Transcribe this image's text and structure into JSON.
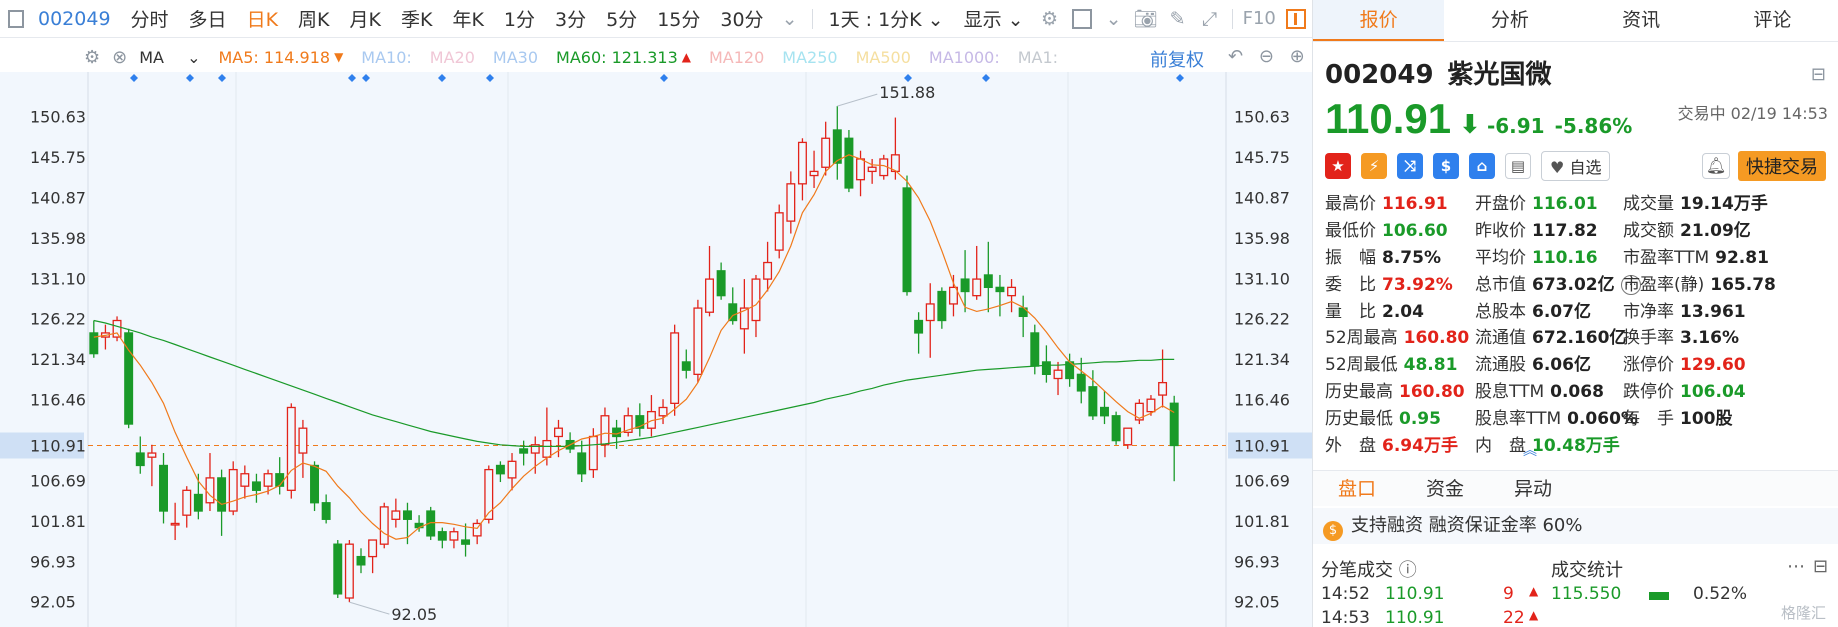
{
  "toolbar": {
    "code": "002049",
    "items": [
      "分时",
      "多日",
      "日K",
      "周K",
      "月K",
      "季K",
      "年K",
      "1分",
      "3分",
      "5分",
      "15分",
      "30分"
    ],
    "active_item": "日K",
    "dropdown_1": "1天 : 1分K",
    "dropdown_2": "显示",
    "f10": "F10"
  },
  "ma_bar": {
    "indicator": "MA",
    "ma5": "MA5: 114.918",
    "ma10": "MA10:",
    "ma20": "MA20",
    "ma30": "MA30",
    "ma60": "MA60: 121.313",
    "ma120": "MA120",
    "ma250": "MA250",
    "ma500": "MA500",
    "ma1000": "MA1000:",
    "ma1": "MA1:",
    "adjust": "前复权",
    "colors": {
      "ma5": "#f07a1b",
      "ma60": "#1a9a29",
      "faded": [
        "#a9c9f0",
        "#f0c7d6",
        "#a9c9f0",
        "#f5b8b8",
        "#a6e3f0",
        "#f5dfa0",
        "#c6b9e6",
        "#c4c9cf"
      ]
    }
  },
  "chart_data": {
    "type": "candlestick",
    "price_levels": [
      150.63,
      145.75,
      140.87,
      135.98,
      131.1,
      126.22,
      121.34,
      116.46,
      110.91,
      106.69,
      101.81,
      96.93,
      92.05
    ],
    "current_price_label": "110.91",
    "high_label": "151.88",
    "low_label": "92.05",
    "ylim": [
      89.0,
      156.0
    ],
    "up_color": "#e2231a",
    "down_color": "#1a9a29",
    "candles": [
      {
        "o": 124.5,
        "h": 126.0,
        "l": 121.5,
        "c": 122.0
      },
      {
        "o": 124.0,
        "h": 125.5,
        "l": 122.5,
        "c": 124.5
      },
      {
        "o": 124.0,
        "h": 126.5,
        "l": 123.5,
        "c": 126.0
      },
      {
        "o": 124.5,
        "h": 125.0,
        "l": 113.0,
        "c": 113.5
      },
      {
        "o": 110.0,
        "h": 112.0,
        "l": 107.5,
        "c": 108.5
      },
      {
        "o": 109.5,
        "h": 111.0,
        "l": 106.0,
        "c": 110.0
      },
      {
        "o": 108.5,
        "h": 110.0,
        "l": 101.5,
        "c": 103.0
      },
      {
        "o": 101.5,
        "h": 104.0,
        "l": 99.5,
        "c": 101.5
      },
      {
        "o": 102.5,
        "h": 106.0,
        "l": 101.0,
        "c": 105.5
      },
      {
        "o": 105.0,
        "h": 107.5,
        "l": 102.0,
        "c": 103.0
      },
      {
        "o": 104.0,
        "h": 110.0,
        "l": 103.0,
        "c": 107.0
      },
      {
        "o": 107.0,
        "h": 108.0,
        "l": 100.0,
        "c": 103.0
      },
      {
        "o": 103.0,
        "h": 109.0,
        "l": 102.5,
        "c": 108.0
      },
      {
        "o": 106.0,
        "h": 108.5,
        "l": 104.5,
        "c": 107.5
      },
      {
        "o": 106.5,
        "h": 107.5,
        "l": 104.0,
        "c": 105.5
      },
      {
        "o": 106.0,
        "h": 108.0,
        "l": 105.0,
        "c": 107.5
      },
      {
        "o": 107.5,
        "h": 109.5,
        "l": 105.0,
        "c": 106.0
      },
      {
        "o": 105.5,
        "h": 116.0,
        "l": 104.5,
        "c": 115.5
      },
      {
        "o": 110.0,
        "h": 114.0,
        "l": 107.0,
        "c": 113.0
      },
      {
        "o": 108.5,
        "h": 109.0,
        "l": 103.0,
        "c": 104.0
      },
      {
        "o": 104.0,
        "h": 105.0,
        "l": 101.5,
        "c": 102.0
      },
      {
        "o": 99.0,
        "h": 99.5,
        "l": 92.5,
        "c": 93.0
      },
      {
        "o": 92.5,
        "h": 99.5,
        "l": 92.0,
        "c": 99.0
      },
      {
        "o": 97.5,
        "h": 98.5,
        "l": 95.5,
        "c": 96.5
      },
      {
        "o": 97.5,
        "h": 99.5,
        "l": 95.5,
        "c": 99.5
      },
      {
        "o": 99.0,
        "h": 104.0,
        "l": 98.5,
        "c": 103.5
      },
      {
        "o": 102.0,
        "h": 104.5,
        "l": 101.0,
        "c": 103.0
      },
      {
        "o": 103.0,
        "h": 104.0,
        "l": 99.0,
        "c": 102.0
      },
      {
        "o": 101.5,
        "h": 102.5,
        "l": 100.5,
        "c": 101.0
      },
      {
        "o": 103.0,
        "h": 103.5,
        "l": 99.5,
        "c": 100.0
      },
      {
        "o": 100.5,
        "h": 101.0,
        "l": 98.5,
        "c": 99.5
      },
      {
        "o": 99.5,
        "h": 101.0,
        "l": 98.5,
        "c": 100.5
      },
      {
        "o": 99.5,
        "h": 101.5,
        "l": 97.5,
        "c": 99.0
      },
      {
        "o": 100.0,
        "h": 102.0,
        "l": 99.0,
        "c": 101.5
      },
      {
        "o": 102.0,
        "h": 108.5,
        "l": 101.5,
        "c": 108.0
      },
      {
        "o": 108.5,
        "h": 109.0,
        "l": 106.5,
        "c": 107.5
      },
      {
        "o": 107.0,
        "h": 110.0,
        "l": 105.5,
        "c": 109.0
      },
      {
        "o": 110.5,
        "h": 111.5,
        "l": 108.5,
        "c": 110.0
      },
      {
        "o": 110.0,
        "h": 112.0,
        "l": 107.5,
        "c": 111.0
      },
      {
        "o": 109.5,
        "h": 115.5,
        "l": 108.5,
        "c": 111.5
      },
      {
        "o": 112.0,
        "h": 114.0,
        "l": 109.5,
        "c": 113.0
      },
      {
        "o": 111.5,
        "h": 112.5,
        "l": 110.0,
        "c": 110.5
      },
      {
        "o": 110.0,
        "h": 111.5,
        "l": 106.5,
        "c": 107.5
      },
      {
        "o": 108.0,
        "h": 113.0,
        "l": 107.0,
        "c": 112.0
      },
      {
        "o": 111.0,
        "h": 115.5,
        "l": 109.5,
        "c": 114.5
      },
      {
        "o": 113.0,
        "h": 114.0,
        "l": 110.5,
        "c": 112.0
      },
      {
        "o": 112.5,
        "h": 115.5,
        "l": 112.0,
        "c": 114.5
      },
      {
        "o": 114.5,
        "h": 116.0,
        "l": 112.0,
        "c": 113.0
      },
      {
        "o": 113.0,
        "h": 117.0,
        "l": 112.0,
        "c": 115.0
      },
      {
        "o": 114.5,
        "h": 116.5,
        "l": 113.5,
        "c": 115.5
      },
      {
        "o": 116.0,
        "h": 125.5,
        "l": 114.5,
        "c": 124.5
      },
      {
        "o": 121.0,
        "h": 122.5,
        "l": 119.0,
        "c": 120.0
      },
      {
        "o": 119.5,
        "h": 128.5,
        "l": 118.5,
        "c": 127.5
      },
      {
        "o": 127.0,
        "h": 135.0,
        "l": 126.5,
        "c": 131.0
      },
      {
        "o": 132.0,
        "h": 133.0,
        "l": 128.5,
        "c": 129.0
      },
      {
        "o": 128.0,
        "h": 130.0,
        "l": 125.5,
        "c": 126.0
      },
      {
        "o": 125.0,
        "h": 131.0,
        "l": 122.0,
        "c": 127.5
      },
      {
        "o": 126.0,
        "h": 131.5,
        "l": 124.0,
        "c": 131.0
      },
      {
        "o": 131.0,
        "h": 135.5,
        "l": 129.5,
        "c": 133.0
      },
      {
        "o": 134.5,
        "h": 140.0,
        "l": 133.5,
        "c": 139.0
      },
      {
        "o": 138.0,
        "h": 144.0,
        "l": 136.5,
        "c": 142.5
      },
      {
        "o": 142.5,
        "h": 148.0,
        "l": 140.5,
        "c": 147.5
      },
      {
        "o": 143.5,
        "h": 146.5,
        "l": 142.0,
        "c": 144.0
      },
      {
        "o": 144.5,
        "h": 150.0,
        "l": 143.5,
        "c": 148.0
      },
      {
        "o": 149.0,
        "h": 151.88,
        "l": 143.0,
        "c": 145.0
      },
      {
        "o": 148.0,
        "h": 149.0,
        "l": 141.5,
        "c": 142.0
      },
      {
        "o": 143.0,
        "h": 146.5,
        "l": 141.0,
        "c": 145.5
      },
      {
        "o": 144.0,
        "h": 145.5,
        "l": 142.5,
        "c": 144.5
      },
      {
        "o": 143.5,
        "h": 146.0,
        "l": 143.0,
        "c": 145.5
      },
      {
        "o": 144.0,
        "h": 150.5,
        "l": 143.0,
        "c": 146.0
      },
      {
        "o": 142.0,
        "h": 143.5,
        "l": 129.0,
        "c": 129.5
      },
      {
        "o": 126.0,
        "h": 127.0,
        "l": 122.0,
        "c": 124.5
      },
      {
        "o": 126.0,
        "h": 130.5,
        "l": 121.5,
        "c": 128.0
      },
      {
        "o": 129.5,
        "h": 130.0,
        "l": 125.0,
        "c": 126.0
      },
      {
        "o": 128.0,
        "h": 131.5,
        "l": 126.5,
        "c": 130.0
      },
      {
        "o": 131.0,
        "h": 134.5,
        "l": 127.0,
        "c": 129.5
      },
      {
        "o": 129.0,
        "h": 135.0,
        "l": 128.5,
        "c": 131.0
      },
      {
        "o": 131.5,
        "h": 135.5,
        "l": 127.0,
        "c": 130.0
      },
      {
        "o": 130.0,
        "h": 131.5,
        "l": 126.5,
        "c": 129.5
      },
      {
        "o": 129.0,
        "h": 131.0,
        "l": 127.0,
        "c": 130.0
      },
      {
        "o": 127.5,
        "h": 129.0,
        "l": 124.0,
        "c": 126.5
      },
      {
        "o": 124.5,
        "h": 125.5,
        "l": 119.5,
        "c": 120.5
      },
      {
        "o": 121.0,
        "h": 123.0,
        "l": 118.5,
        "c": 119.5
      },
      {
        "o": 119.0,
        "h": 121.0,
        "l": 117.0,
        "c": 120.0
      },
      {
        "o": 121.0,
        "h": 122.0,
        "l": 118.0,
        "c": 119.0
      },
      {
        "o": 119.5,
        "h": 121.5,
        "l": 116.0,
        "c": 117.5
      },
      {
        "o": 118.0,
        "h": 120.0,
        "l": 114.0,
        "c": 114.5
      },
      {
        "o": 115.5,
        "h": 117.5,
        "l": 113.5,
        "c": 114.5
      },
      {
        "o": 114.5,
        "h": 115.0,
        "l": 111.0,
        "c": 111.5
      },
      {
        "o": 111.0,
        "h": 113.0,
        "l": 110.5,
        "c": 113.0
      },
      {
        "o": 114.0,
        "h": 116.5,
        "l": 113.5,
        "c": 116.0
      },
      {
        "o": 115.0,
        "h": 117.0,
        "l": 114.5,
        "c": 116.5
      },
      {
        "o": 117.0,
        "h": 122.5,
        "l": 115.5,
        "c": 118.5
      },
      {
        "o": 116.01,
        "h": 116.91,
        "l": 106.6,
        "c": 110.91
      }
    ],
    "ma5": [
      124.0,
      124.2,
      124.5,
      122.4,
      120.6,
      118.5,
      116.0,
      112.5,
      109.5,
      106.6,
      104.9,
      103.8,
      104.2,
      104.7,
      105.0,
      105.4,
      106.1,
      107.9,
      108.8,
      108.4,
      107.8,
      106.0,
      104.6,
      102.9,
      101.5,
      100.3,
      99.6,
      99.8,
      101.0,
      101.6,
      101.6,
      101.4,
      101.1,
      100.9,
      102.8,
      104.0,
      105.7,
      107.2,
      108.4,
      109.4,
      110.3,
      111.0,
      111.7,
      112.0,
      112.4,
      112.3,
      112.8,
      113.2,
      113.9,
      114.2,
      115.3,
      116.5,
      118.5,
      121.5,
      124.8,
      126.6,
      127.2,
      127.9,
      129.7,
      131.9,
      135.0,
      139.0,
      141.2,
      144.0,
      145.3,
      146.0,
      145.5,
      144.8,
      144.7,
      144.1,
      142.8,
      140.8,
      138.0,
      134.4,
      130.5,
      127.6,
      127.1,
      127.4,
      127.8,
      128.3,
      127.6,
      126.3,
      124.6,
      122.7,
      121.0,
      119.9,
      118.8,
      117.5,
      116.2,
      115.0,
      114.2,
      114.8,
      115.7,
      114.9
    ],
    "ma60": [
      126.0,
      125.7,
      125.3,
      124.9,
      124.5,
      124.0,
      123.6,
      123.1,
      122.6,
      122.1,
      121.6,
      121.1,
      120.6,
      120.1,
      119.6,
      119.1,
      118.6,
      118.1,
      117.6,
      117.1,
      116.6,
      116.1,
      115.6,
      115.1,
      114.6,
      114.2,
      113.8,
      113.4,
      113.0,
      112.6,
      112.3,
      112.0,
      111.7,
      111.4,
      111.2,
      111.0,
      110.9,
      110.8,
      110.8,
      110.8,
      110.8,
      110.8,
      110.9,
      111.0,
      111.1,
      111.3,
      111.5,
      111.7,
      111.9,
      112.2,
      112.5,
      112.8,
      113.1,
      113.4,
      113.7,
      114.0,
      114.3,
      114.6,
      114.9,
      115.2,
      115.5,
      115.8,
      116.1,
      116.5,
      116.8,
      117.1,
      117.5,
      117.8,
      118.2,
      118.5,
      118.8,
      119.0,
      119.2,
      119.4,
      119.6,
      119.8,
      120.0,
      120.1,
      120.2,
      120.3,
      120.4,
      120.5,
      120.6,
      120.6,
      120.7,
      120.8,
      120.9,
      121.0,
      121.0,
      121.1,
      121.2,
      121.2,
      121.3,
      121.3
    ]
  },
  "panel": {
    "tabs": [
      "报价",
      "分析",
      "资讯",
      "评论"
    ],
    "active_tab": "报价",
    "code": "002049",
    "name": "紫光国微",
    "last_price": "110.91",
    "change": "-6.91",
    "change_pct": "-5.86%",
    "status": "交易中 02/19 14:53",
    "watch_label": "自选",
    "quick_trade": "快捷交易",
    "stats_col1": [
      {
        "label": "最高价",
        "value": "116.91",
        "color": "red"
      },
      {
        "label": "最低价",
        "value": "106.60",
        "color": "green"
      },
      {
        "label": "振　幅",
        "value": "8.75%",
        "color": "dark"
      },
      {
        "label": "委　比",
        "value": "73.92%",
        "color": "red"
      },
      {
        "label": "量　比",
        "value": "2.04",
        "color": "dark"
      },
      {
        "label": "52周最高",
        "value": "160.80",
        "color": "red"
      },
      {
        "label": "52周最低",
        "value": "48.81",
        "color": "green"
      },
      {
        "label": "历史最高",
        "value": "160.80",
        "color": "red"
      },
      {
        "label": "历史最低",
        "value": "0.95",
        "color": "green"
      },
      {
        "label": "外　盘",
        "value": "6.94万手",
        "color": "red"
      }
    ],
    "stats_col2": [
      {
        "label": "开盘价",
        "value": "116.01",
        "color": "green"
      },
      {
        "label": "昨收价",
        "value": "117.82",
        "color": "dark"
      },
      {
        "label": "平均价",
        "value": "110.16",
        "color": "green"
      },
      {
        "label": "总市值",
        "value": "673.02亿",
        "color": "dark"
      },
      {
        "label": "总股本",
        "value": "6.07亿",
        "color": "dark"
      },
      {
        "label": "流通值",
        "value": "672.160亿",
        "color": "dark"
      },
      {
        "label": "流通股",
        "value": "6.06亿",
        "color": "dark"
      },
      {
        "label": "股息TTM",
        "value": "0.068",
        "color": "dark"
      },
      {
        "label": "股息率TTM",
        "value": "0.060%",
        "color": "dark"
      },
      {
        "label": "内　盘",
        "value": "10.48万手",
        "color": "green"
      }
    ],
    "stats_col3": [
      {
        "label": "成交量",
        "value": "19.14万手",
        "color": "dark"
      },
      {
        "label": "成交额",
        "value": "21.09亿",
        "color": "dark"
      },
      {
        "label": "市盈率TTM",
        "value": "92.81",
        "color": "dark"
      },
      {
        "label": "市盈率(静)",
        "value": "165.78",
        "color": "dark"
      },
      {
        "label": "市净率",
        "value": "13.961",
        "color": "dark"
      },
      {
        "label": "换手率",
        "value": "3.16%",
        "color": "dark"
      },
      {
        "label": "涨停价",
        "value": "129.60",
        "color": "red"
      },
      {
        "label": "跌停价",
        "value": "106.04",
        "color": "green"
      },
      {
        "label": "每　手",
        "value": "100股",
        "color": "dark"
      }
    ],
    "sub_tabs": [
      "盘口",
      "资金",
      "异动"
    ],
    "active_sub_tab": "盘口",
    "margin_text": "支持融资 融资保证金率 60%",
    "trade_title": "分笔成交",
    "stats_title": "成交统计",
    "ticks": [
      {
        "time": "14:52",
        "price": "110.91",
        "vol": "9"
      },
      {
        "time": "14:53",
        "price": "110.91",
        "vol": "22"
      }
    ],
    "trade_stats": [
      {
        "price": "115.550",
        "pct": "0.52%"
      }
    ],
    "watermark": "格隆汇"
  }
}
